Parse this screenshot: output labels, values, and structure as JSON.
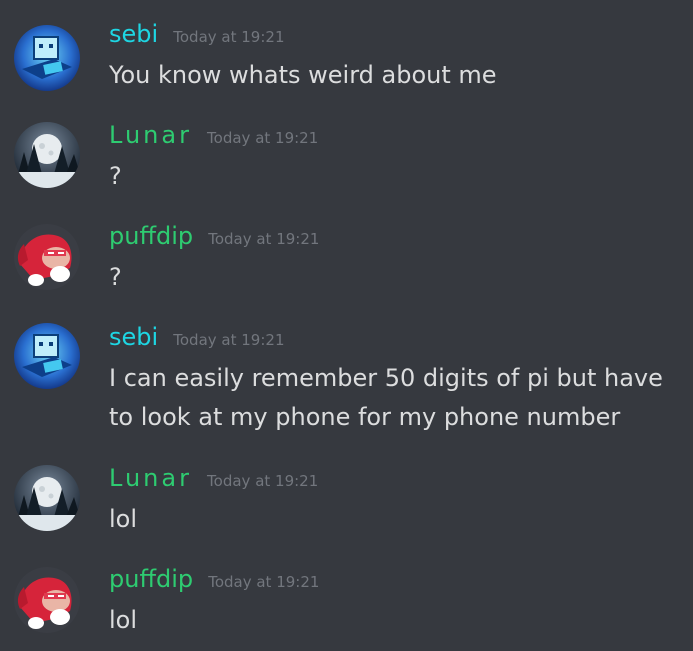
{
  "colors": {
    "background": "#36393f",
    "timestamp": "#72767d",
    "message_text": "#dcddde",
    "sebi": "#1ed6e3",
    "lunar": "#2ecc71",
    "puffdip": "#2ecc71"
  },
  "messages": [
    {
      "author": "sebi",
      "timestamp": "Today at 19:21",
      "text": "You know whats weird about me",
      "avatar": "robot-avatar-icon"
    },
    {
      "author": "Lunar",
      "timestamp": "Today at 19:21",
      "text": "?",
      "avatar": "moon-forest-avatar-icon"
    },
    {
      "author": "puffdip",
      "timestamp": "Today at 19:21",
      "text": "?",
      "avatar": "knuckles-avatar-icon"
    },
    {
      "author": "sebi",
      "timestamp": "Today at 19:21",
      "text": "I can easily remember 50 digits of pi but have to look at my phone for my phone number",
      "avatar": "robot-avatar-icon"
    },
    {
      "author": "Lunar",
      "timestamp": "Today at 19:21",
      "text": "lol",
      "avatar": "moon-forest-avatar-icon"
    },
    {
      "author": "puffdip",
      "timestamp": "Today at 19:21",
      "text": "lol",
      "avatar": "knuckles-avatar-icon"
    }
  ]
}
